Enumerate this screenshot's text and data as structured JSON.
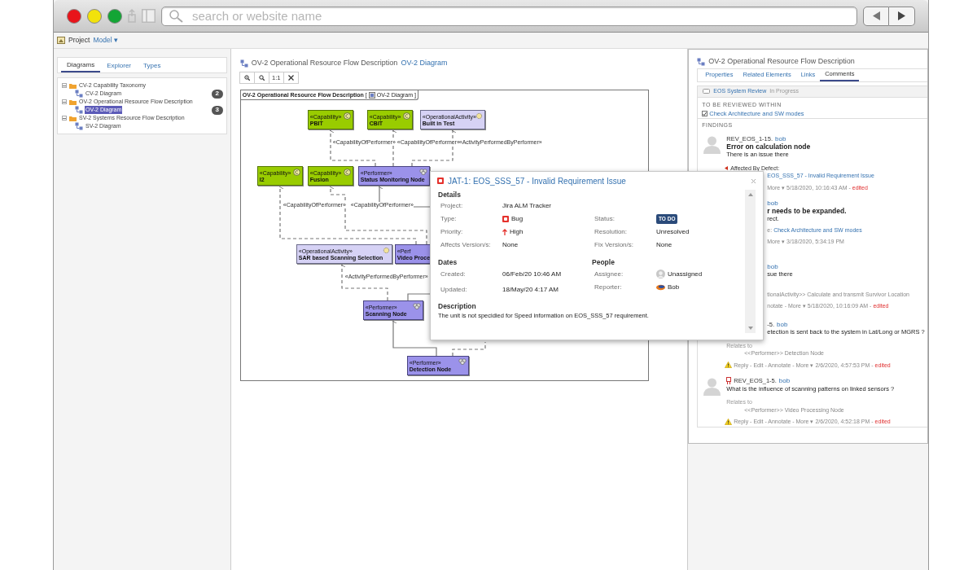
{
  "browser": {
    "search_placeholder": "search or website name"
  },
  "toolbar": {
    "project": "Project",
    "model": "Model ▾"
  },
  "left": {
    "tabs": [
      {
        "label": "Diagrams",
        "selected": true
      },
      {
        "label": "Explorer",
        "selected": false
      },
      {
        "label": "Types",
        "selected": false
      }
    ],
    "tree": [
      {
        "label": "CV-2 Capability Taxonomy",
        "expanded": true,
        "children": [
          {
            "label": "CV-2 Diagram",
            "selected": false,
            "count": "2"
          }
        ]
      },
      {
        "label": "OV-2 Operational Resource Flow Description",
        "expanded": true,
        "children": [
          {
            "label": "OV-2 Diagram",
            "selected": true,
            "count": "3"
          }
        ]
      },
      {
        "label": "SV-2 Systems Resource Flow Description",
        "expanded": true,
        "children": [
          {
            "label": "SV-2 Diagram",
            "selected": false
          }
        ]
      }
    ]
  },
  "center": {
    "title": "OV-2 Operational Resource Flow Description",
    "title_link": "OV-2 Diagram",
    "zoom_buttons": [
      {
        "kind": "zoom_in"
      },
      {
        "kind": "zoom_out"
      },
      {
        "kind": "text",
        "label": "1:1"
      },
      {
        "kind": "fit"
      }
    ],
    "diagram": {
      "frame_title": "OV-2 Operational Resource Flow Description",
      "frame_open": "[",
      "frame_type": "OV-2 Diagram",
      "frame_close": "]",
      "nodes": [
        {
          "kind": "capability",
          "stereotype": "«Capability»",
          "name": "PBIT",
          "clipped": false
        },
        {
          "kind": "capability",
          "stereotype": "«Capability»",
          "name": "CBIT",
          "clipped": false
        },
        {
          "kind": "activity",
          "stereotype": "«OperationalActivity»",
          "name": "Built in Test",
          "clipped": false
        },
        {
          "kind": "capability",
          "stereotype": "«Capability»",
          "name": "I2",
          "clipped": false
        },
        {
          "kind": "capability",
          "stereotype": "«Capability»",
          "name": "Fusion",
          "clipped": false
        },
        {
          "kind": "performer",
          "stereotype": "«Performer»",
          "name": "Status Monitoring Node",
          "clipped": false
        },
        {
          "kind": "activity",
          "stereotype": "«OperationalActivity»",
          "name": "SAR based Scanning Selection",
          "clipped": false
        },
        {
          "kind": "performer",
          "stereotype": "«Perf",
          "name": "Video Proce",
          "clipped": true
        },
        {
          "kind": "performer",
          "stereotype": "«Performer»",
          "name": "Scanning Node",
          "clipped": false
        },
        {
          "kind": "performer",
          "stereotype": "«Performer»",
          "name": "Detection Node",
          "clipped": false
        }
      ],
      "labels": [
        "«CapabilityOfPerformer»",
        "«CapabilityOfPerformer»",
        "«ActivityPerformedByPerformer»",
        "«CapabilityOfPerformer»",
        "«CapabilityOfPerformer»",
        "«ActivityPerformedByPerformer»"
      ]
    }
  },
  "popup": {
    "title": "JAT-1: EOS_SSS_57 - Invalid Requirement Issue",
    "details_heading": "Details",
    "details": [
      {
        "label": "Project:",
        "value": "Jira ALM Tracker",
        "kind": "text"
      },
      {
        "label": "Type:",
        "value": "Bug",
        "kind": "bug"
      },
      {
        "label": "Status:",
        "value": "TO DO",
        "kind": "badge"
      },
      {
        "label": "Priority:",
        "value": "High",
        "kind": "priority"
      },
      {
        "label": "Resolution:",
        "value": "Unresolved",
        "kind": "text"
      },
      {
        "label": "Affects Version/s:",
        "value": "None",
        "kind": "text"
      },
      {
        "label": "Fix Version/s:",
        "value": "None",
        "kind": "text"
      }
    ],
    "dates_heading": "Dates",
    "dates": [
      {
        "label": "Created:",
        "value": "06/Feb/20 10:46 AM"
      },
      {
        "label": "Updated:",
        "value": "18/May/20 4:17 AM"
      }
    ],
    "people_heading": "People",
    "people": [
      {
        "label": "Assignee:",
        "value": "Unassigned",
        "kind": "unassigned"
      },
      {
        "label": "Reporter:",
        "value": "Bob",
        "kind": "user"
      }
    ],
    "description_heading": "Description",
    "description": "The unit is not specidied for Speed information on EOS_SSS_57 requirement."
  },
  "right": {
    "title": "OV-2 Operational Resource Flow Description",
    "tabs": [
      {
        "label": "Properties",
        "selected": false
      },
      {
        "label": "Related Elements",
        "selected": false
      },
      {
        "label": "Links",
        "selected": false
      },
      {
        "label": "Comments",
        "selected": true
      }
    ],
    "review": {
      "name": "EOS System Review",
      "status": "In Progress"
    },
    "within_heading": "TO BE REVIEWED WITHIN",
    "within_item": {
      "label": "Check Architecture and SW modes",
      "checked": true
    },
    "findings_heading": "FINDINGS",
    "comments": [
      {
        "avatar": true,
        "lines": [
          {
            "kind": "meta",
            "id": "REV_EOS_1-15.",
            "author": "bob",
            "flag": false,
            "clipped": false
          },
          {
            "kind": "title",
            "text": "Error on calculation node",
            "clipped": false
          },
          {
            "kind": "body",
            "text": "There is an issue there",
            "clipped": false
          },
          {
            "kind": "defect",
            "text": "Affected By Defect:",
            "clipped": false
          },
          {
            "kind": "link",
            "text": "EOS_SSS_57 - Invalid Requirement Issue",
            "clipped": true
          },
          {
            "kind": "actions",
            "text": "More ▾ 5/18/2020, 10:16:43 AM -",
            "edited": "edited",
            "warning": false,
            "clipped": true
          }
        ]
      },
      {
        "avatar": false,
        "lines": [
          {
            "kind": "meta",
            "author": "bob",
            "flag": false,
            "clipped": true
          },
          {
            "kind": "title",
            "text": "r needs to be expanded.",
            "clipped": true
          },
          {
            "kind": "body",
            "text": "rect.",
            "clipped": true
          },
          {
            "kind": "relates_link",
            "prefix": "e:",
            "text": "Check Architecture and SW modes",
            "clipped": true
          },
          {
            "kind": "actions",
            "text": "More ▾ 3/18/2020, 5:34:19 PM",
            "warning": false,
            "clipped": true
          }
        ]
      },
      {
        "avatar": false,
        "lines": [
          {
            "kind": "meta",
            "author": "bob",
            "flag": false,
            "clipped": true
          },
          {
            "kind": "body",
            "text": "sue there",
            "clipped": true
          },
          {
            "kind": "item",
            "text": "tionalActivity>> Calculate and transmit Survivor Location",
            "clipped": true
          },
          {
            "kind": "actions",
            "text": "notate - More ▾ 5/18/2020, 10:16:09 AM -",
            "edited": "edited",
            "warning": false,
            "clipped": true
          }
        ]
      },
      {
        "avatar": false,
        "lines": [
          {
            "kind": "meta",
            "id": "-5.",
            "author": "bob",
            "flag": false,
            "clipped": true
          },
          {
            "kind": "body",
            "text": "etection is sent back to the system in Lat/Long or MGRS ?",
            "clipped": true
          },
          {
            "kind": "relates",
            "text": "Relates to",
            "clipped": false
          },
          {
            "kind": "item",
            "text": "<<Performer>> Detection Node",
            "clipped": false
          },
          {
            "kind": "actions",
            "text": "Reply - Edit - Annotate - More ▾ 2/6/2020, 4:57:53 PM -",
            "edited": "edited",
            "warning": true,
            "clipped": false
          }
        ]
      },
      {
        "avatar": true,
        "lines": [
          {
            "kind": "meta",
            "id": "REV_EOS_1-5.",
            "author": "bob",
            "flag": true,
            "clipped": false
          },
          {
            "kind": "body",
            "text": "What is the influence of scanning patterns on linked sensors ?",
            "clipped": false
          },
          {
            "kind": "relates",
            "text": "Relates to",
            "clipped": false
          },
          {
            "kind": "item",
            "text": "<<Performer>> Video Processing Node",
            "clipped": false
          },
          {
            "kind": "actions",
            "text": "Reply - Edit - Annotate - More ▾ 2/6/2020, 4:52:18 PM -",
            "edited": "edited",
            "warning": true,
            "clipped": false
          }
        ]
      }
    ]
  }
}
